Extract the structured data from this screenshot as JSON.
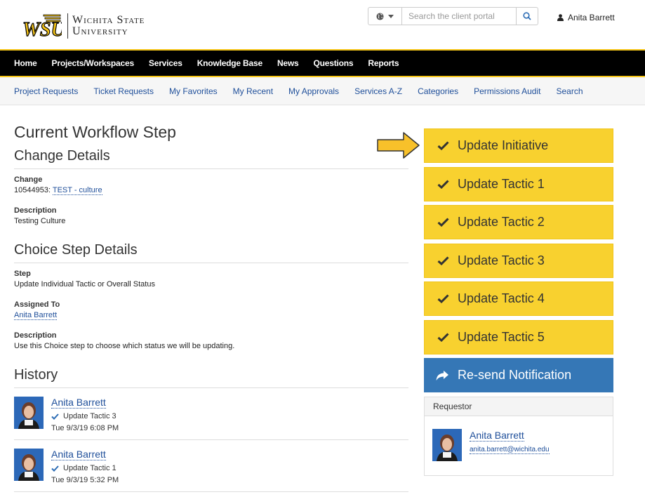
{
  "header": {
    "university_line1": "Wichita State",
    "university_line2": "University",
    "logo_mark": "WSU",
    "search_placeholder": "Search the client portal",
    "user_name": "Anita Barrett"
  },
  "primary_nav": [
    {
      "label": "Home"
    },
    {
      "label": "Projects/Workspaces"
    },
    {
      "label": "Services"
    },
    {
      "label": "Knowledge Base"
    },
    {
      "label": "News"
    },
    {
      "label": "Questions"
    },
    {
      "label": "Reports"
    }
  ],
  "secondary_nav": [
    {
      "label": "Project Requests"
    },
    {
      "label": "Ticket Requests"
    },
    {
      "label": "My Favorites"
    },
    {
      "label": "My Recent"
    },
    {
      "label": "My Approvals"
    },
    {
      "label": "Services A-Z"
    },
    {
      "label": "Categories"
    },
    {
      "label": "Permissions Audit"
    },
    {
      "label": "Search"
    }
  ],
  "main": {
    "page_title": "Current Workflow Step",
    "change_details": {
      "title": "Change Details",
      "change_label": "Change",
      "change_id": "10544953:",
      "change_link": "TEST - culture",
      "description_label": "Description",
      "description_value": "Testing Culture"
    },
    "choice_step": {
      "title": "Choice Step Details",
      "step_label": "Step",
      "step_value": "Update Individual Tactic or Overall Status",
      "assigned_label": "Assigned To",
      "assigned_value": "Anita Barrett",
      "description_label": "Description",
      "description_value": "Use this Choice step to choose which status we will be updating."
    },
    "history": {
      "title": "History",
      "items": [
        {
          "name": "Anita Barrett",
          "step": "Update Tactic 3",
          "time": "Tue 9/3/19 6:08 PM"
        },
        {
          "name": "Anita Barrett",
          "step": "Update Tactic 1",
          "time": "Tue 9/3/19 5:32 PM"
        }
      ]
    }
  },
  "choices": [
    {
      "label": "Update Initiative"
    },
    {
      "label": "Update Tactic 1"
    },
    {
      "label": "Update Tactic 2"
    },
    {
      "label": "Update Tactic 3"
    },
    {
      "label": "Update Tactic 4"
    },
    {
      "label": "Update Tactic 5"
    }
  ],
  "resend_label": "Re-send Notification",
  "requestor": {
    "heading": "Requestor",
    "name": "Anita Barrett",
    "email": "anita.barrett@wichita.edu"
  },
  "colors": {
    "choice_yellow": "#f8d12f",
    "resend_blue": "#3577b6",
    "nav_black": "#000000",
    "accent_gold": "#f5c518",
    "link_blue": "#1f4f9a"
  },
  "icons": {
    "check": "check-icon",
    "share": "share-arrow-icon",
    "globe": "globe-icon",
    "search": "search-icon",
    "user": "user-icon",
    "pointer": "pointer-arrow-icon"
  }
}
